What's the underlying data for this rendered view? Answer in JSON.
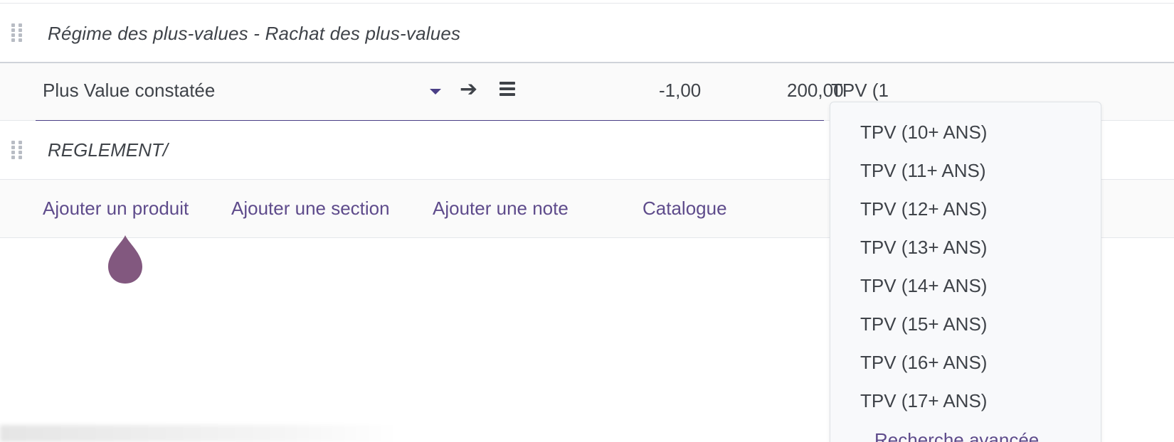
{
  "section_line": {
    "title": "Régime des plus-values - Rachat des plus-values"
  },
  "edit_line": {
    "product": "Plus Value constatée",
    "quantity": "-1,00",
    "unit_price": "200,00",
    "tax_input": "TPV (1"
  },
  "note_line": {
    "text": "REGLEMENT/"
  },
  "actions": {
    "add_product": "Ajouter un produit",
    "add_section": "Ajouter une section",
    "add_note": "Ajouter une note",
    "catalog": "Catalogue"
  },
  "tax_dropdown": {
    "items": [
      "TPV (10+ ANS)",
      "TPV (11+ ANS)",
      "TPV (12+ ANS)",
      "TPV (13+ ANS)",
      "TPV (14+ ANS)",
      "TPV (15+ ANS)",
      "TPV (16+ ANS)",
      "TPV (17+ ANS)"
    ],
    "advanced_search": "Recherche avancée"
  },
  "icons": {
    "drag_handle": "drag-handle-icon",
    "dropdown_caret": "caret-down-icon",
    "internal_link": "arrow-right-icon",
    "details": "menu-lines-icon",
    "cursor_marker": "drop-marker-icon"
  },
  "colors": {
    "accent": "#5e4b8b",
    "text": "#3f4349",
    "marker": "#7b4f78"
  }
}
